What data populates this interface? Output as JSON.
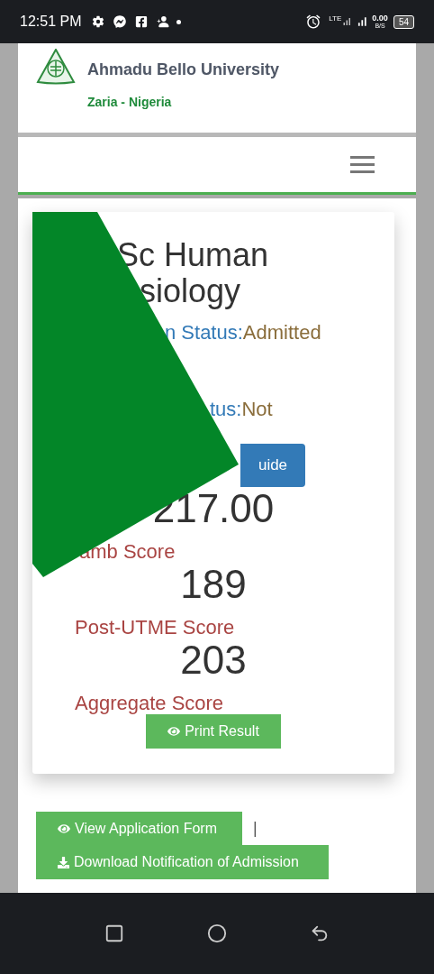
{
  "status_bar": {
    "time": "12:51 PM",
    "network": "LTE",
    "speed": "0.00",
    "speed_unit": "B/S",
    "battery": "54"
  },
  "header": {
    "title": "Ahmadu Bello University",
    "subtitle": "Zaria - Nigeria"
  },
  "card": {
    "title_lines": [
      "Sc Human",
      "siology"
    ],
    "statuses": [
      {
        "label": "n Status:",
        "value": "Admitted"
      },
      {
        "label": "tus:",
        "value": "Not"
      }
    ],
    "guide_button": "uide",
    "score_lines": [
      {
        "kind": "value",
        "text": "217.00"
      },
      {
        "kind": "label",
        "text": "amb Score"
      },
      {
        "kind": "value",
        "text": "189"
      },
      {
        "kind": "label",
        "text": "Post-UTME Score"
      },
      {
        "kind": "value",
        "text": "203"
      },
      {
        "kind": "label",
        "text": "Aggregate Score"
      }
    ],
    "print_button": "Print Result"
  },
  "actions": {
    "view_button": "View Application Form",
    "separator": "|",
    "download_button": "Download Notification of Admission"
  }
}
